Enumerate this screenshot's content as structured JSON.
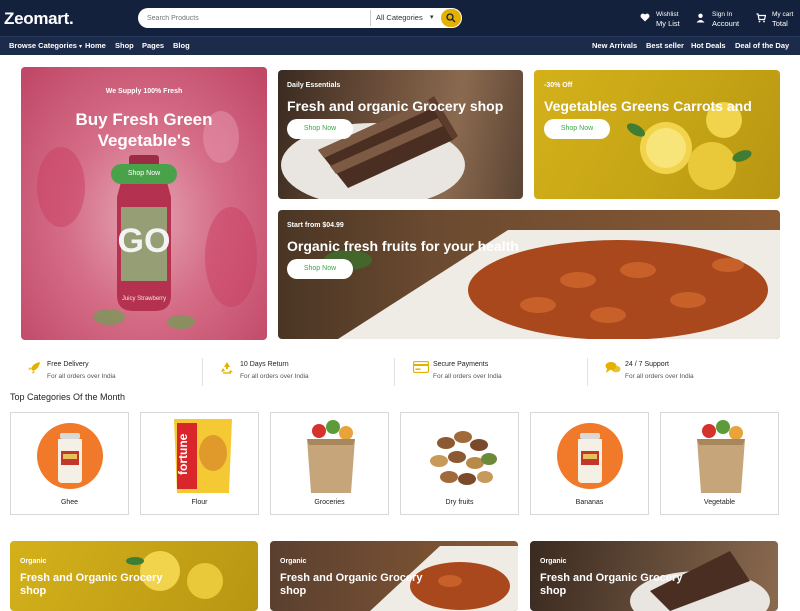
{
  "header": {
    "logo": "Zeomart.",
    "search_placeholder": "Search Products",
    "category_select": "All Categories",
    "wishlist_line1": "Wishlist",
    "wishlist_line2": "My List",
    "signin_line1": "Sign In",
    "signin_line2": "Account",
    "cart_line1": "My cart",
    "cart_line2": "Total"
  },
  "nav": {
    "browse": "Browse Categories",
    "left_links": [
      "Home",
      "Shop",
      "Pages",
      "Blog"
    ],
    "right_links": [
      "New Arrivals",
      "Best seller",
      "Hot Deals",
      "Deal of the Day"
    ]
  },
  "banners": {
    "main": {
      "subtitle": "We Supply 100% Fresh",
      "title_line1": "Buy Fresh Green",
      "title_line2": "Vegetable's",
      "button": "Shop Now",
      "bottle_label": "Juicy Strawberry"
    },
    "cake": {
      "subtitle": "Daily Essentials",
      "title": "Fresh and organic Grocery shop",
      "button": "Shop Now"
    },
    "veg": {
      "subtitle": "-30% Off",
      "title": "Vegetables Greens Carrots and",
      "button": "Shop Now"
    },
    "pasta": {
      "subtitle": "Start from $04.99",
      "title": "Organic fresh fruits for your health",
      "button": "Shop Now"
    }
  },
  "features": [
    {
      "icon": "rocket-icon",
      "title": "Free Delivery",
      "subtitle": "For all orders over India"
    },
    {
      "icon": "recycle-icon",
      "title": "10 Days Return",
      "subtitle": "For all orders over India"
    },
    {
      "icon": "credit-card-icon",
      "title": "Secure Payments",
      "subtitle": "For all orders over India"
    },
    {
      "icon": "chat-icon",
      "title": "24 / 7 Support",
      "subtitle": "For all orders over India"
    }
  ],
  "categories": {
    "title": "Top Categories Of the Month",
    "items": [
      "Ghee",
      "Flour",
      "Groceries",
      "Dry fruits",
      "Bananas",
      "Vegetable"
    ]
  },
  "promos": [
    {
      "subtitle": "Organic",
      "title": "Fresh and Organic Grocery shop"
    },
    {
      "subtitle": "Organic",
      "title": "Fresh and Organic Grocery shop"
    },
    {
      "subtitle": "Organic",
      "title": "Fresh and Organic Grocery shop"
    }
  ],
  "colors": {
    "header_bg": "#14213d",
    "nav_bg": "#1c2b4a",
    "accent_yellow": "#e5b100",
    "button_green": "#49a24a",
    "feature_icon": "#e5b100"
  }
}
